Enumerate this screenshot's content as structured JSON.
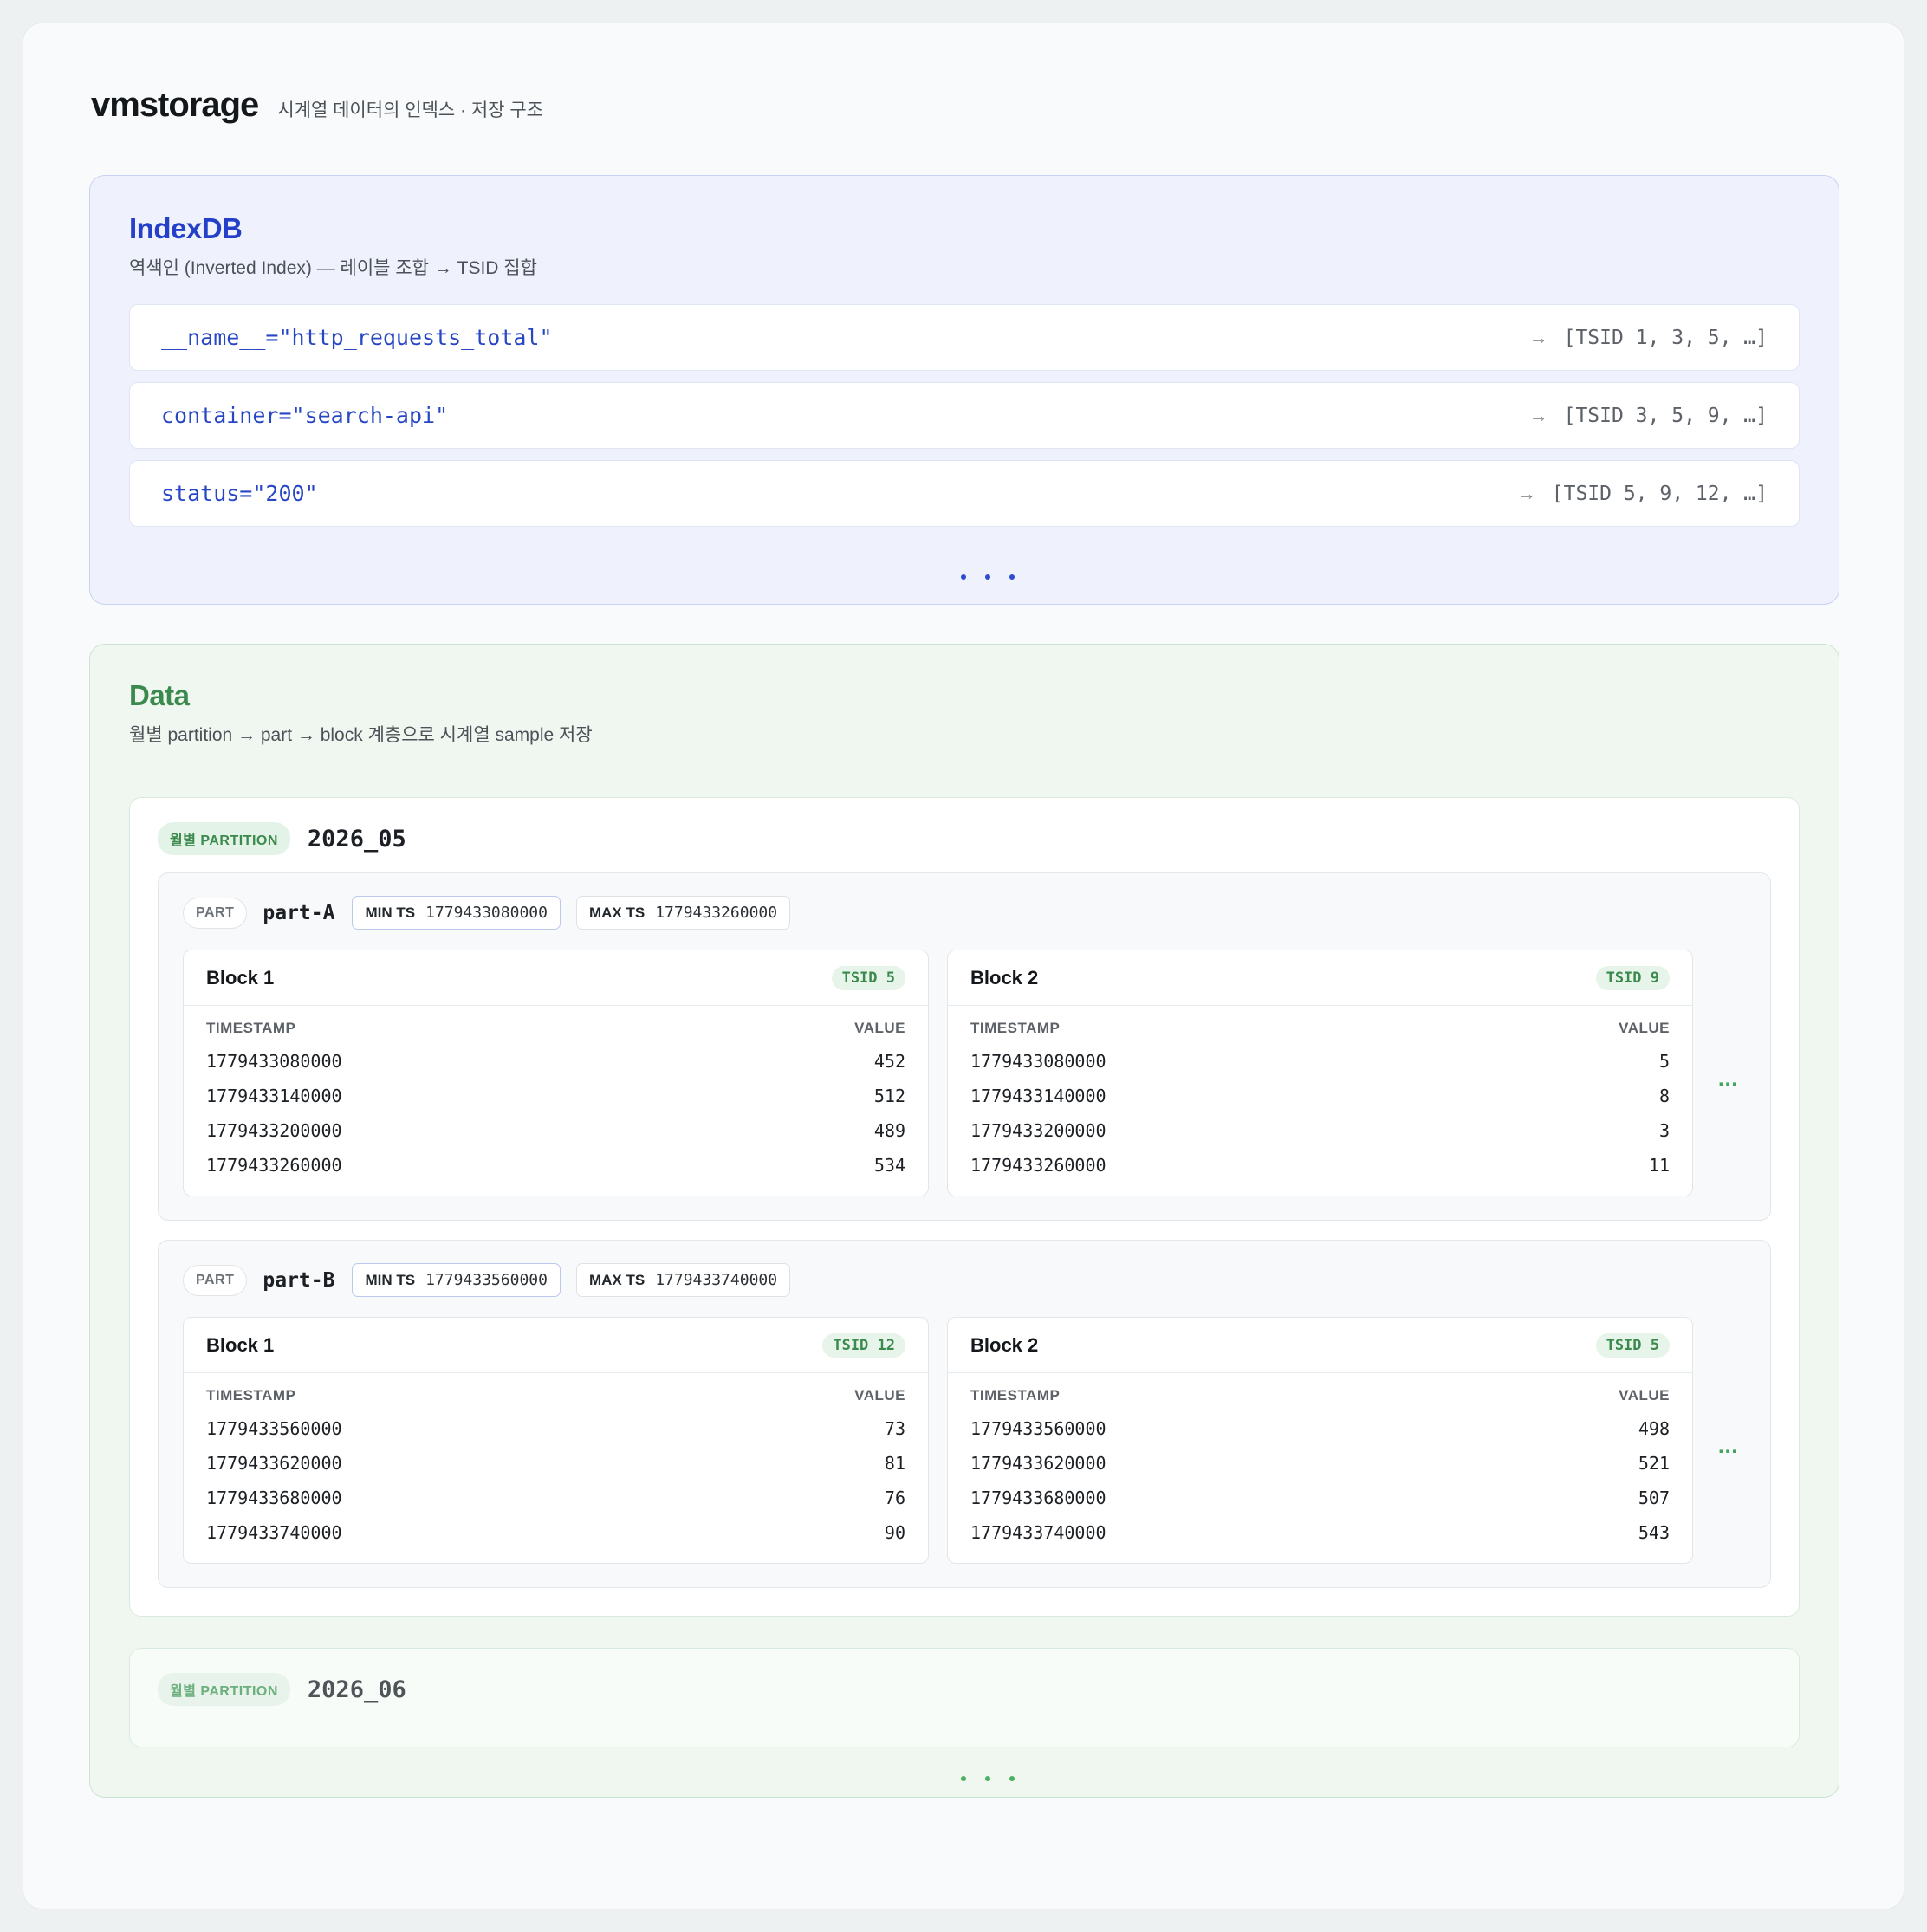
{
  "header": {
    "title": "vmstorage",
    "subtitle": "시계열 데이터의 인덱스 · 저장 구조"
  },
  "indexdb": {
    "title": "IndexDB",
    "subtitle": "역색인 (Inverted Index) — 레이블 조합 → TSID 집합",
    "rows": [
      {
        "label": "__name__=\"http_requests_total\"",
        "arrow": "→",
        "tsids": "[TSID 1, 3, 5, …]"
      },
      {
        "label": "container=\"search-api\"",
        "arrow": "→",
        "tsids": "[TSID 3, 5, 9, …]"
      },
      {
        "label": "status=\"200\"",
        "arrow": "→",
        "tsids": "[TSID 5, 9, 12, …]"
      }
    ]
  },
  "data": {
    "title": "Data",
    "subtitle": "월별 partition → part → block 계층으로 시계열 sample 저장",
    "partitions": [
      {
        "badge": "월별 PARTITION",
        "name": "2026_05",
        "parts": [
          {
            "badge": "PART",
            "name": "part-A",
            "min_label": "MIN TS",
            "min_value": "1779433080000",
            "max_label": "MAX TS",
            "max_value": "1779433260000",
            "more": "...",
            "blocks": [
              {
                "title": "Block 1",
                "tsid": "TSID 5",
                "col_ts": "TIMESTAMP",
                "col_val": "VALUE",
                "rows": [
                  [
                    "1779433080000",
                    "452"
                  ],
                  [
                    "1779433140000",
                    "512"
                  ],
                  [
                    "1779433200000",
                    "489"
                  ],
                  [
                    "1779433260000",
                    "534"
                  ]
                ]
              },
              {
                "title": "Block 2",
                "tsid": "TSID 9",
                "col_ts": "TIMESTAMP",
                "col_val": "VALUE",
                "rows": [
                  [
                    "1779433080000",
                    "5"
                  ],
                  [
                    "1779433140000",
                    "8"
                  ],
                  [
                    "1779433200000",
                    "3"
                  ],
                  [
                    "1779433260000",
                    "11"
                  ]
                ]
              }
            ]
          },
          {
            "badge": "PART",
            "name": "part-B",
            "min_label": "MIN TS",
            "min_value": "1779433560000",
            "max_label": "MAX TS",
            "max_value": "1779433740000",
            "more": "...",
            "blocks": [
              {
                "title": "Block 1",
                "tsid": "TSID 12",
                "col_ts": "TIMESTAMP",
                "col_val": "VALUE",
                "rows": [
                  [
                    "1779433560000",
                    "73"
                  ],
                  [
                    "1779433620000",
                    "81"
                  ],
                  [
                    "1779433680000",
                    "76"
                  ],
                  [
                    "1779433740000",
                    "90"
                  ]
                ]
              },
              {
                "title": "Block 2",
                "tsid": "TSID 5",
                "col_ts": "TIMESTAMP",
                "col_val": "VALUE",
                "rows": [
                  [
                    "1779433560000",
                    "498"
                  ],
                  [
                    "1779433620000",
                    "521"
                  ],
                  [
                    "1779433680000",
                    "507"
                  ],
                  [
                    "1779433740000",
                    "543"
                  ]
                ]
              }
            ]
          }
        ]
      },
      {
        "badge": "월별 PARTITION",
        "name": "2026_06"
      }
    ]
  },
  "colors": {
    "index_accent": "#2440c8",
    "data_accent": "#3b8a4d"
  }
}
